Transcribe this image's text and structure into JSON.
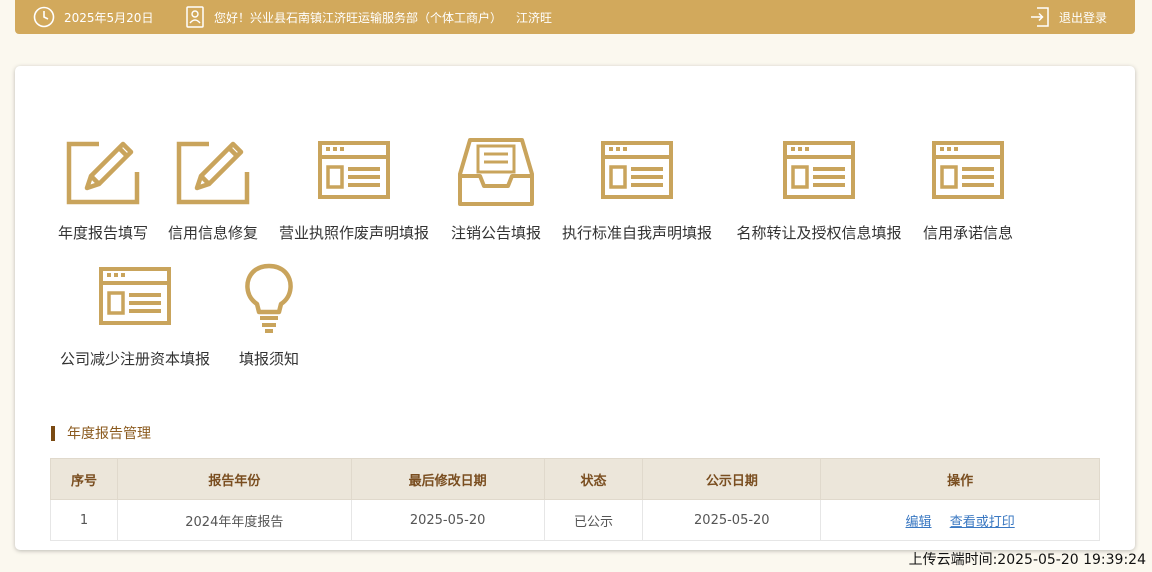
{
  "header": {
    "date": "2025年5月20日",
    "greeting": "您好！兴业县石南镇江济旺运输服务部（个体工商户）",
    "user_name": "江济旺",
    "logout_label": "退出登录"
  },
  "tiles": [
    {
      "label": "年度报告填写"
    },
    {
      "label": "信用信息修复"
    },
    {
      "label": "营业执照作废声明填报"
    },
    {
      "label": "注销公告填报"
    },
    {
      "label": "执行标准自我声明填报"
    },
    {
      "label": "名称转让及授权信息填报"
    },
    {
      "label": "信用承诺信息"
    },
    {
      "label": "公司减少注册资本填报"
    },
    {
      "label": "填报须知"
    }
  ],
  "section": {
    "title": "年度报告管理"
  },
  "table": {
    "headers": [
      "序号",
      "报告年份",
      "最后修改日期",
      "状态",
      "公示日期",
      "操作"
    ],
    "rows": [
      {
        "index": "1",
        "year": "2024年年度报告",
        "modified": "2025-05-20",
        "status": "已公示",
        "published": "2025-05-20",
        "edit_label": "编辑",
        "print_label": "查看或打印"
      }
    ]
  },
  "footer": {
    "upload_time": "上传云端时间:2025-05-20 19:39:24"
  },
  "colors": {
    "accent": "#d2a95c",
    "icon": "#c9a45c",
    "link": "#3a78c2"
  }
}
